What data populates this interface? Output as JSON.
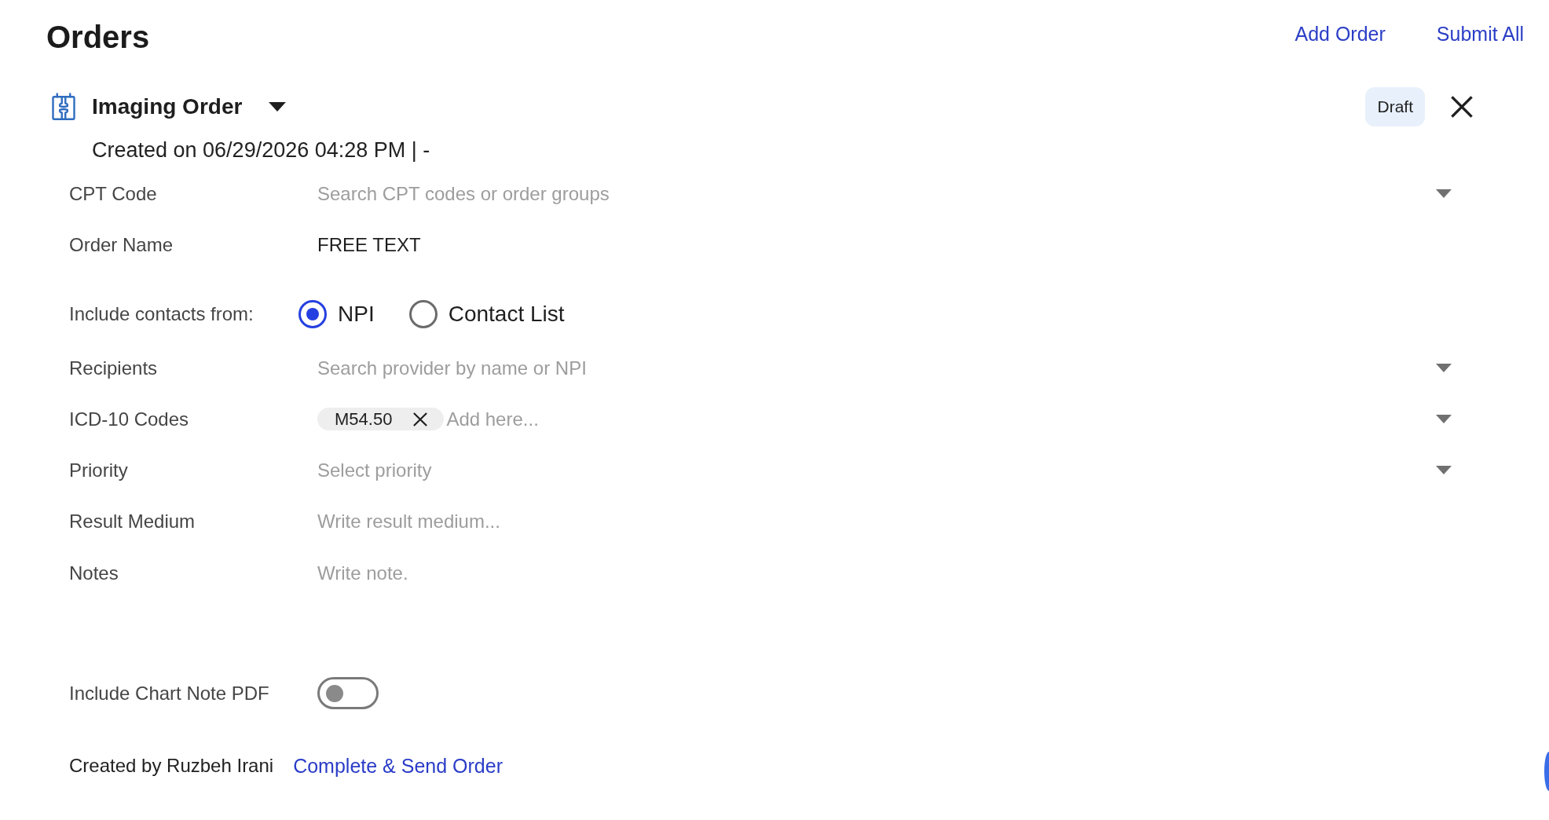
{
  "header": {
    "title": "Orders",
    "actions": [
      "Add Order",
      "Submit All"
    ]
  },
  "order": {
    "title": "Imaging Order",
    "status": "Draft",
    "created": "Created on 06/29/2026 04:28 PM | -",
    "fields": [
      {
        "kind": "select",
        "label": "CPT Code",
        "placeholder": "Search CPT codes or order groups"
      },
      {
        "kind": "text",
        "label": "Order Name",
        "value": "FREE TEXT"
      },
      {
        "kind": "radio",
        "label": "Include contacts from:",
        "options": [
          {
            "label": "NPI",
            "selected": true
          },
          {
            "label": "Contact List",
            "selected": false
          }
        ]
      },
      {
        "kind": "select",
        "label": "Recipients",
        "placeholder": "Search provider by name or NPI"
      },
      {
        "kind": "tags",
        "label": "ICD-10 Codes",
        "tags": [
          "M54.50"
        ],
        "placeholder": "Add here..."
      },
      {
        "kind": "select",
        "label": "Priority",
        "placeholder": "Select priority"
      },
      {
        "kind": "text",
        "label": "Result Medium",
        "placeholder": "Write result medium..."
      },
      {
        "kind": "textarea",
        "label": "Notes",
        "placeholder": "Write note."
      },
      {
        "kind": "toggle",
        "label": "Include Chart Note PDF",
        "on": false
      }
    ],
    "created_by": "Created by Ruzbeh Irani",
    "complete_action": "Complete & Send Order"
  }
}
